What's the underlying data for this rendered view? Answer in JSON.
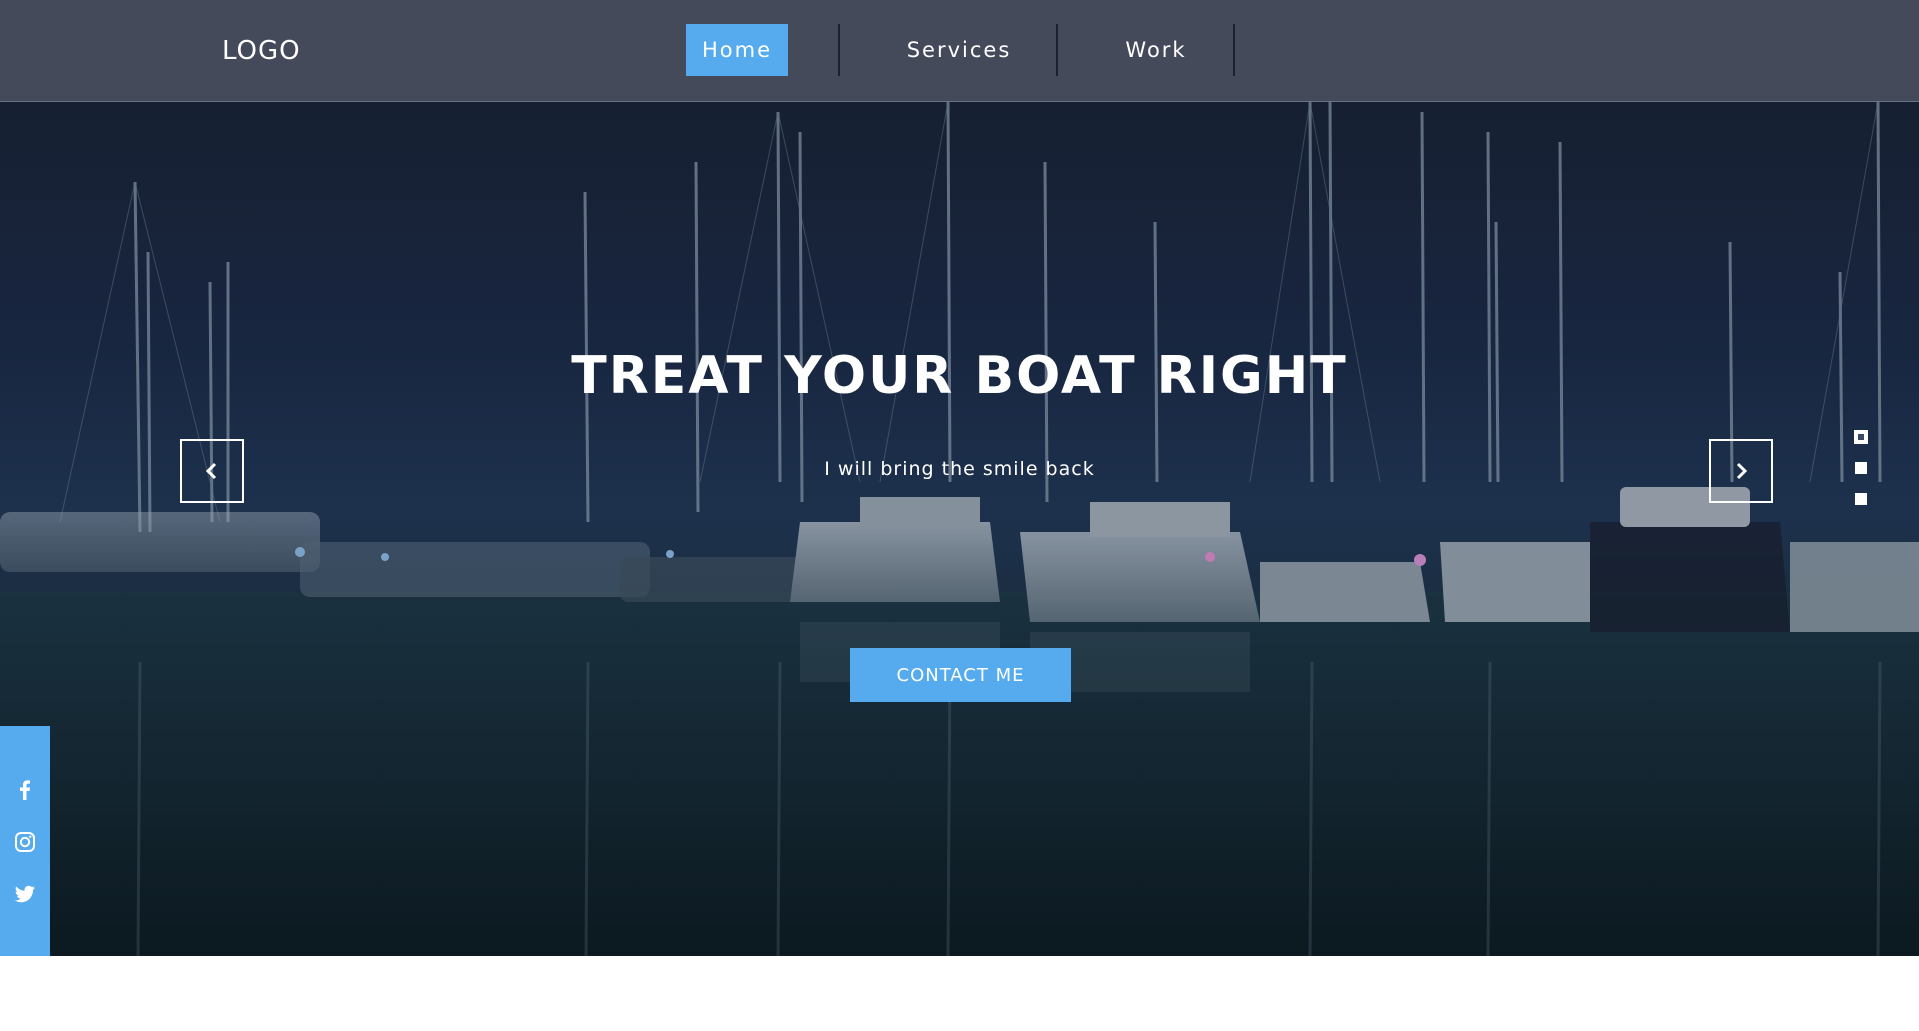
{
  "header": {
    "logo": "LOGO",
    "nav": [
      {
        "label": "Home",
        "active": true
      },
      {
        "label": "Services",
        "active": false
      },
      {
        "label": "Work",
        "active": false
      }
    ]
  },
  "hero": {
    "title": "TREAT YOUR BOAT RIGHT",
    "subtitle": "I will bring the smile back",
    "cta_label": "CONTACT ME",
    "prev_icon": "chevron-left-icon",
    "next_icon": "chevron-right-icon",
    "slides_count": 3,
    "active_slide": 1
  },
  "social": [
    "facebook-icon",
    "instagram-icon",
    "twitter-icon"
  ],
  "colors": {
    "header_bg": "#454a5b",
    "accent": "#55abee",
    "text": "#ffffff"
  }
}
